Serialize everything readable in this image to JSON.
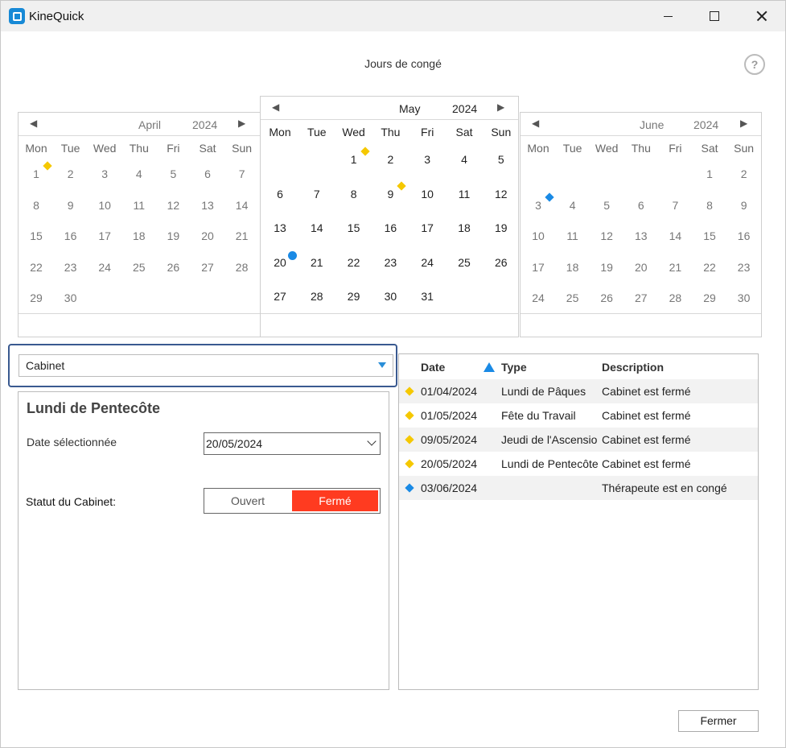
{
  "window": {
    "app_title": "KineQuick",
    "icon": "kinequick-logo-icon"
  },
  "page": {
    "heading": "Jours de congé",
    "help_symbol": "?"
  },
  "weekdays": [
    "Mon",
    "Tue",
    "Wed",
    "Thu",
    "Fri",
    "Sat",
    "Sun"
  ],
  "calendars": {
    "april": {
      "month": "April",
      "year": "2024",
      "prev": "◀",
      "next": "▶",
      "days": [
        "1",
        "2",
        "3",
        "4",
        "5",
        "6",
        "7",
        "8",
        "9",
        "10",
        "11",
        "12",
        "13",
        "14",
        "15",
        "16",
        "17",
        "18",
        "19",
        "20",
        "21",
        "22",
        "23",
        "24",
        "25",
        "26",
        "27",
        "28",
        "29",
        "30"
      ],
      "first_weekday": 0
    },
    "may": {
      "month": "May",
      "year": "2024",
      "prev": "◀",
      "next": "▶",
      "days": [
        "1",
        "2",
        "3",
        "4",
        "5",
        "6",
        "7",
        "8",
        "9",
        "10",
        "11",
        "12",
        "13",
        "14",
        "15",
        "16",
        "17",
        "18",
        "19",
        "20",
        "21",
        "22",
        "23",
        "24",
        "25",
        "26",
        "27",
        "28",
        "29",
        "30",
        "31"
      ],
      "first_weekday": 2
    },
    "june": {
      "month": "June",
      "year": "2024",
      "prev": "◀",
      "next": "▶",
      "days": [
        "1",
        "2",
        "3",
        "4",
        "5",
        "6",
        "7",
        "8",
        "9",
        "10",
        "11",
        "12",
        "13",
        "14",
        "15",
        "16",
        "17",
        "18",
        "19",
        "20",
        "21",
        "22",
        "23",
        "24",
        "25",
        "26",
        "27",
        "28",
        "29",
        "30"
      ],
      "first_weekday": 5
    }
  },
  "markers": [
    {
      "calendar": "april",
      "day": 1,
      "kind": "diamond",
      "color": "#f5c800"
    },
    {
      "calendar": "may",
      "day": 1,
      "kind": "diamond",
      "color": "#f5c800"
    },
    {
      "calendar": "may",
      "day": 9,
      "kind": "diamond",
      "color": "#f5c800"
    },
    {
      "calendar": "may",
      "day": 20,
      "kind": "dot",
      "color": "#1a8ae5"
    },
    {
      "calendar": "june",
      "day": 3,
      "kind": "diamond",
      "color": "#1a8ae5"
    }
  ],
  "scope_select": {
    "value": "Cabinet"
  },
  "detail": {
    "holiday_name": "Lundi de Pentecôte",
    "date_label": "Date sélectionnée",
    "date_value": "20/05/2024",
    "status_label": "Statut du Cabinet:",
    "open_label": "Ouvert",
    "closed_label": "Fermé",
    "closed_color": "#ff3b20"
  },
  "holiday_list": {
    "columns": [
      "Date",
      "Type",
      "Description"
    ],
    "rows": [
      {
        "date": "01/04/2024",
        "type": "Lundi de Pâques",
        "description": "Cabinet est fermé",
        "marker_color": "#f5c800"
      },
      {
        "date": "01/05/2024",
        "type": "Fête du Travail",
        "description": "Cabinet est fermé",
        "marker_color": "#f5c800"
      },
      {
        "date": "09/05/2024",
        "type": "Jeudi de l'Ascension",
        "description": "Cabinet est fermé",
        "marker_color": "#f5c800"
      },
      {
        "date": "20/05/2024",
        "type": "Lundi de Pentecôte",
        "description": "Cabinet est fermé",
        "marker_color": "#f5c800"
      },
      {
        "date": "03/06/2024",
        "type": "",
        "description": "Thérapeute est en congé",
        "marker_color": "#1a8ae5"
      }
    ]
  },
  "footer": {
    "close_label": "Fermer"
  }
}
